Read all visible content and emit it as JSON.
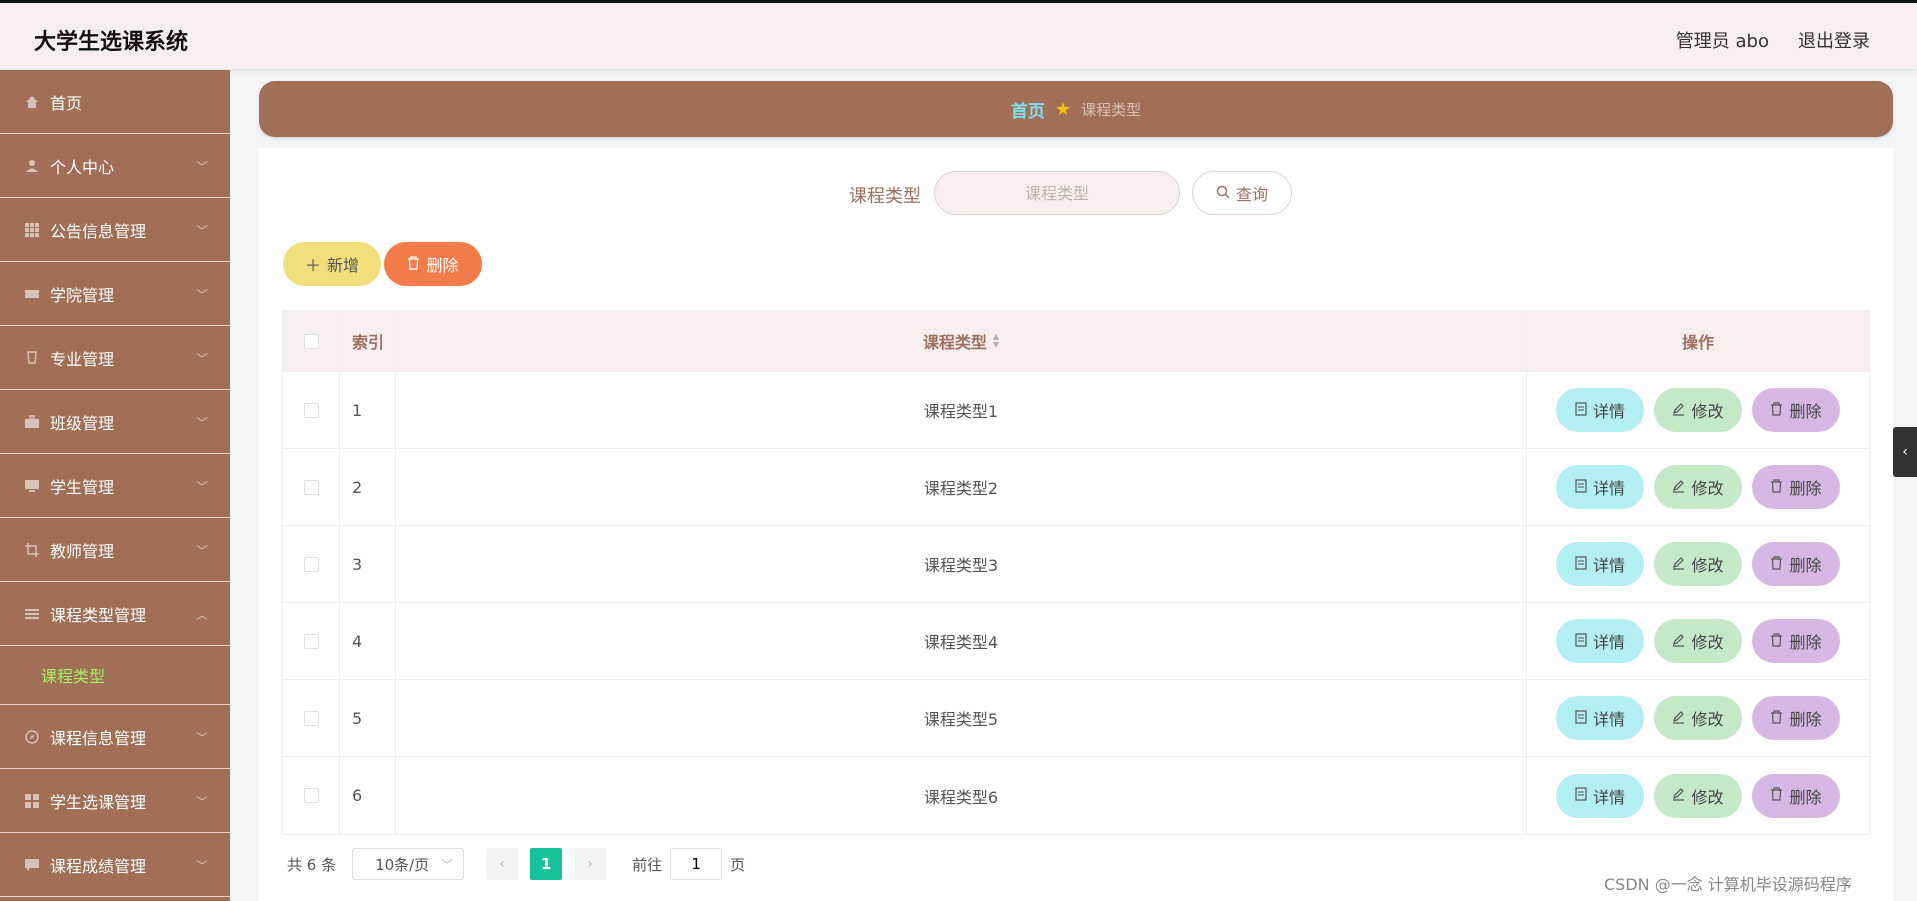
{
  "header": {
    "app_title": "大学生选课系统",
    "admin_label": "管理员 abo",
    "logout": "退出登录"
  },
  "sidebar": {
    "items": [
      {
        "label": "首页",
        "icon": "home-icon"
      },
      {
        "label": "个人中心",
        "icon": "user-icon"
      },
      {
        "label": "公告信息管理",
        "icon": "grid-icon"
      },
      {
        "label": "学院管理",
        "icon": "ticket-icon"
      },
      {
        "label": "专业管理",
        "icon": "cup-icon"
      },
      {
        "label": "班级管理",
        "icon": "briefcase-icon"
      },
      {
        "label": "学生管理",
        "icon": "monitor-icon"
      },
      {
        "label": "教师管理",
        "icon": "crop-icon"
      },
      {
        "label": "课程类型管理",
        "icon": "list-icon"
      },
      {
        "label": "课程信息管理",
        "icon": "compass-icon"
      },
      {
        "label": "学生选课管理",
        "icon": "grid-icon"
      },
      {
        "label": "课程成绩管理",
        "icon": "chat-icon"
      }
    ],
    "sub_item": "课程类型"
  },
  "breadcrumb": {
    "home": "首页",
    "current": "课程类型"
  },
  "search": {
    "label": "课程类型",
    "placeholder": "课程类型",
    "button": "查询"
  },
  "actions": {
    "add": "新增",
    "delete": "删除"
  },
  "table": {
    "headers": {
      "index": "索引",
      "type": "课程类型",
      "ops": "操作"
    },
    "rows": [
      {
        "index": "1",
        "type": "课程类型1"
      },
      {
        "index": "2",
        "type": "课程类型2"
      },
      {
        "index": "3",
        "type": "课程类型3"
      },
      {
        "index": "4",
        "type": "课程类型4"
      },
      {
        "index": "5",
        "type": "课程类型5"
      },
      {
        "index": "6",
        "type": "课程类型6"
      }
    ],
    "op_labels": {
      "detail": "详情",
      "edit": "修改",
      "delete": "删除"
    }
  },
  "pagination": {
    "total": "共 6 条",
    "page_size": "10条/页",
    "current_page": "1",
    "goto_label": "前往",
    "goto_value": "1",
    "page_suffix": "页"
  },
  "watermark": "CSDN @一念 计算机毕设源码程序",
  "colors": {
    "sidebar": "#a06f56",
    "accent_green": "#17c29b",
    "detail": "#b2eef2",
    "edit": "#c5e8c7",
    "delete": "#d7b8e4"
  }
}
